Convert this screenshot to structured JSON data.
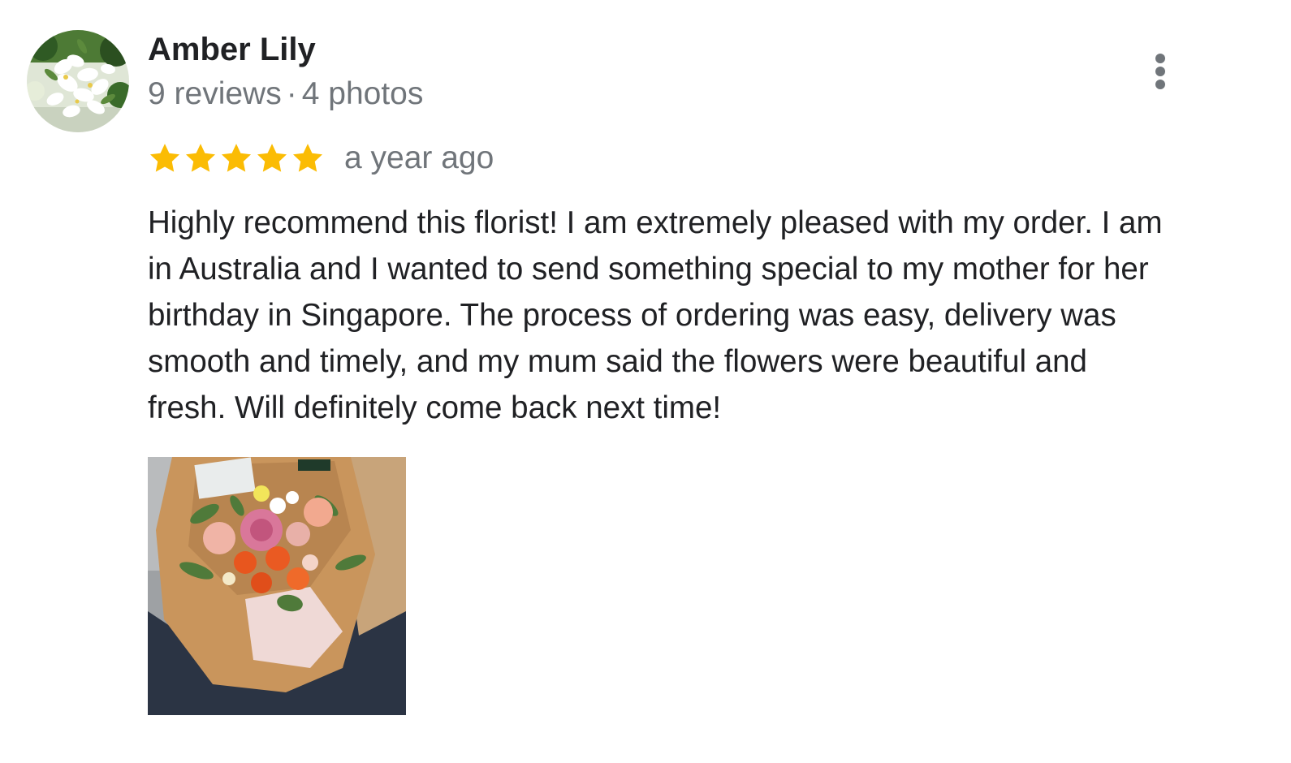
{
  "review": {
    "author": {
      "name": "Amber Lily",
      "reviews_count": "9 reviews",
      "separator": "·",
      "photos_count": "4 photos",
      "avatar_icon": "avatar-white-flowers"
    },
    "rating": {
      "value": 5,
      "max": 5,
      "star_color": "#fbbc04"
    },
    "date": "a year ago",
    "text_lines": [
      "Highly recommend this florist! I am extremely pleased with my order. I am",
      "in Australia and I wanted to send something special to my mother for her",
      "birthday in Singapore. The process of ordering was easy, delivery was",
      "smooth and timely, and my mum said the flowers were beautiful and",
      "fresh. Will definitely come back next time!"
    ],
    "more_icon": "more-vertical-icon",
    "photo_icon": "bouquet-photo"
  }
}
